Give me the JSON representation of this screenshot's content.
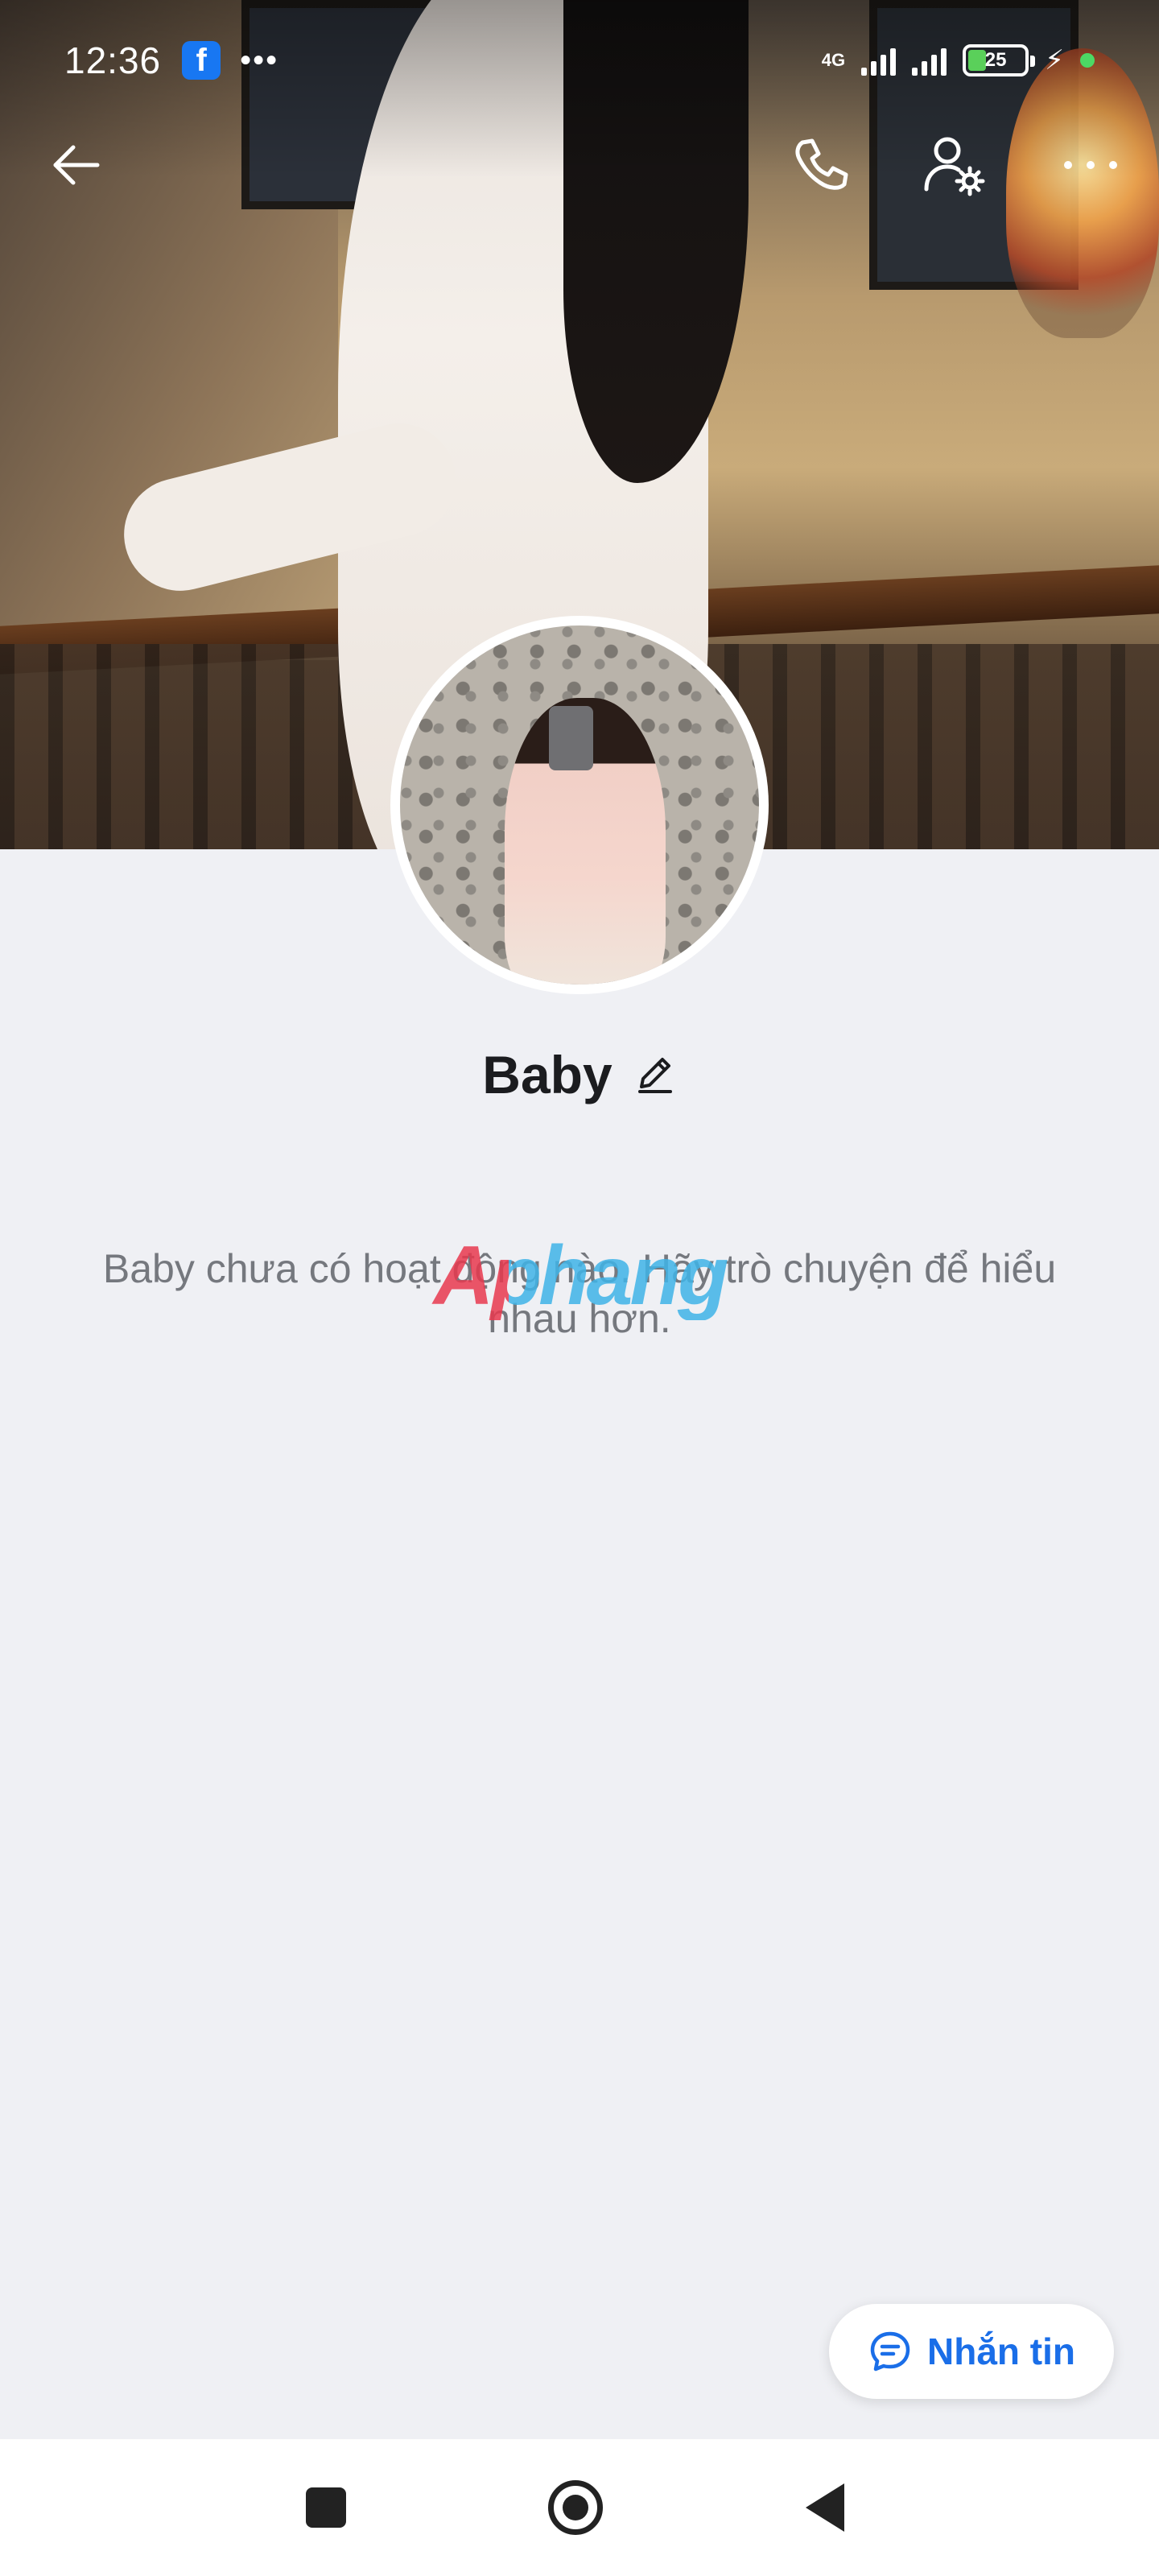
{
  "status_bar": {
    "time": "12:36",
    "notification_app": "f",
    "more_indicator": "•••",
    "network_label": "4G",
    "battery_level": "25",
    "charging_icon": "⚡"
  },
  "profile": {
    "name": "Baby",
    "empty_message": "Baby chưa có hoạt động nào. Hãy trò chuyện để hiểu nhau hơn.",
    "watermark": "Aphang"
  },
  "message_button": {
    "label": "Nhắn tin"
  },
  "colors": {
    "accent": "#1a6ee8",
    "background": "#eff0f4",
    "text_secondary": "#75787e"
  },
  "icons": {
    "back": "back-arrow-icon",
    "call": "phone-icon",
    "profile_settings": "user-settings-icon",
    "more": "more-horizontal-icon",
    "edit": "pencil-icon",
    "chat": "chat-bubble-icon"
  }
}
